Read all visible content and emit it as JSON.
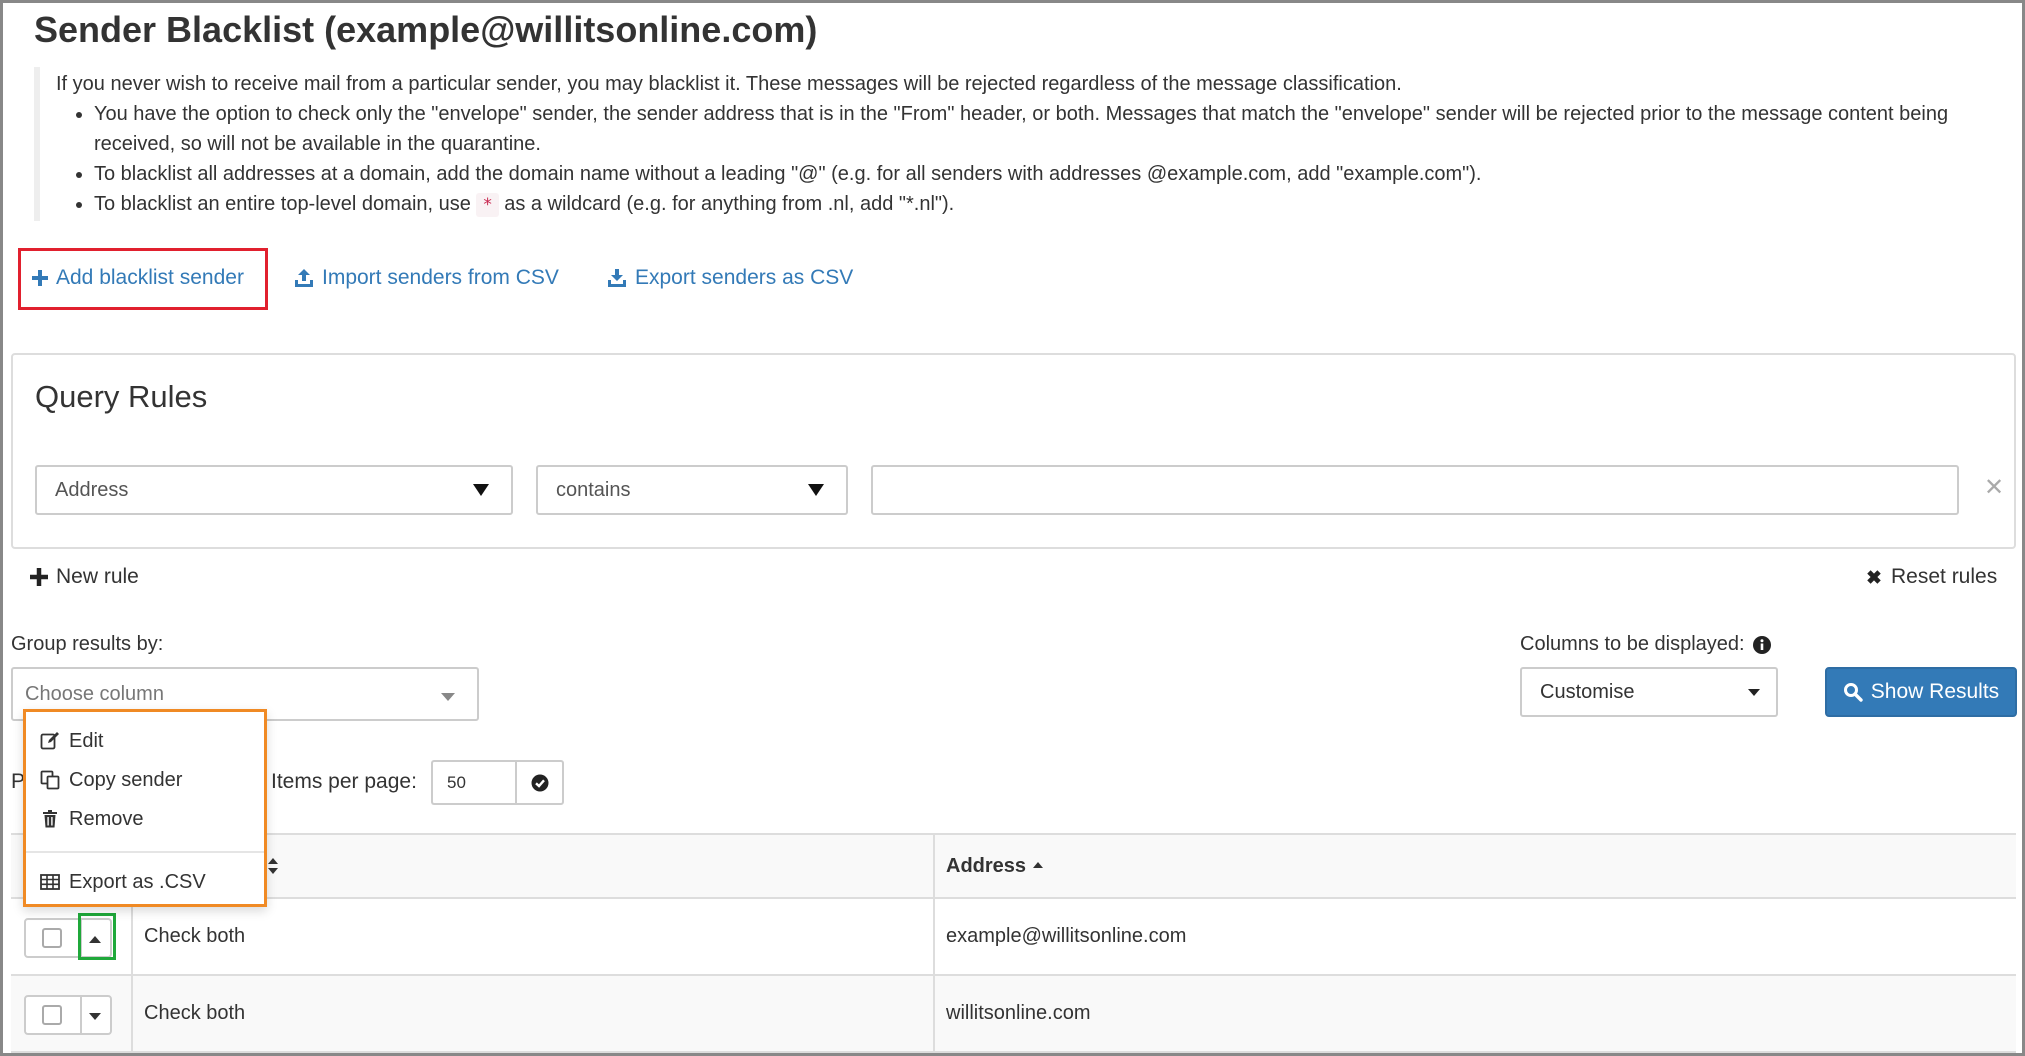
{
  "page": {
    "title": "Sender Blacklist (example@willitsonline.com)"
  },
  "info": {
    "intro": "If you never wish to receive mail from a particular sender, you may blacklist it. These messages will be rejected regardless of the message classification.",
    "bullet1": "You have the option to check only the \"envelope\" sender, the sender address that is in the \"From\" header, or both. Messages that match the \"envelope\" sender will be rejected prior to the message content being received, so will not be available in the quarantine.",
    "bullet2": "To blacklist all addresses at a domain, add the domain name without a leading \"@\" (e.g. for all senders with addresses @example.com, add \"example.com\").",
    "bullet3_before": "To blacklist an entire top-level domain, use",
    "bullet3_code": "*",
    "bullet3_after": "as a wildcard (e.g. for anything from .nl, add \"*.nl\")."
  },
  "actions": {
    "add": "Add blacklist sender",
    "import": "Import senders from CSV",
    "export": "Export senders as CSV"
  },
  "query": {
    "title": "Query Rules",
    "field": "Address",
    "operator": "contains",
    "value": "",
    "clear_icon": "times-icon"
  },
  "rules": {
    "new_rule": "New rule",
    "reset_rules": "Reset rules"
  },
  "group": {
    "label": "Group results by:",
    "placeholder": "Choose column"
  },
  "columns": {
    "label": "Columns to be displayed:",
    "value": "Customise"
  },
  "show_results": "Show Results",
  "paging": {
    "hidden_prefix": "P",
    "items_label": "Items per page:",
    "items_value": "50"
  },
  "row_menu": {
    "edit": "Edit",
    "copy": "Copy sender",
    "remove": "Remove",
    "export": "Export as .CSV"
  },
  "table": {
    "headers": {
      "address": "Address"
    },
    "rows": [
      {
        "check": "Check both",
        "address": "example@willitsonline.com"
      },
      {
        "check": "Check both",
        "address": "willitsonline.com"
      }
    ]
  },
  "colors": {
    "link": "#337ab7",
    "primary_button": "#337ab7",
    "highlight_red": "#e1202e",
    "highlight_orange": "#f08a24",
    "highlight_green": "#1fa83a"
  }
}
